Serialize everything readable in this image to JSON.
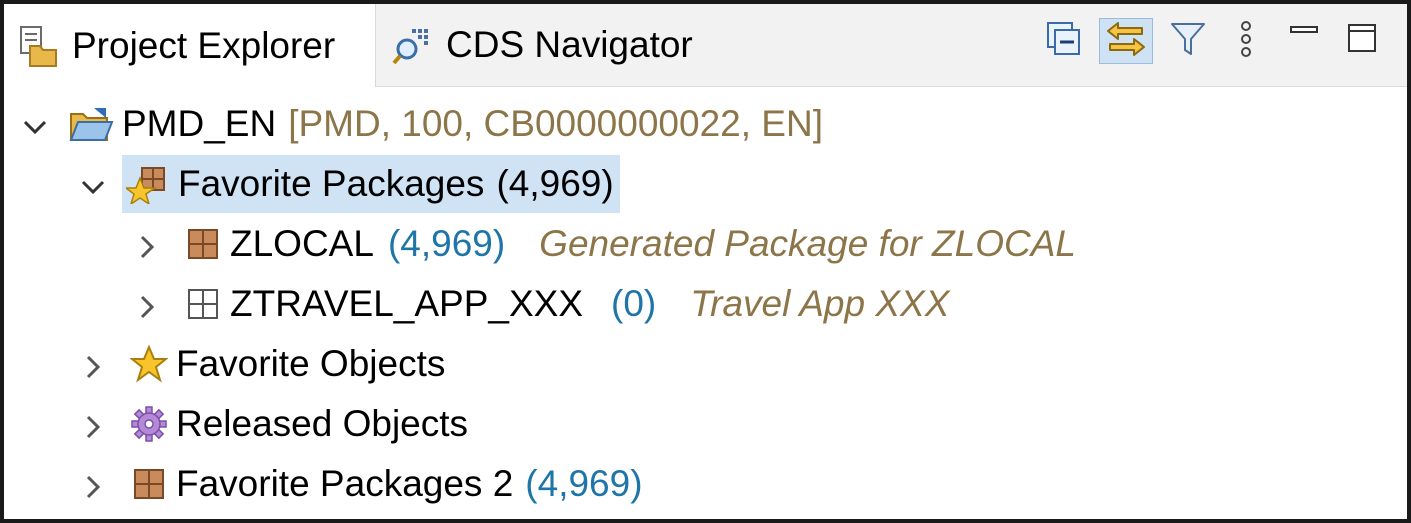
{
  "tabs": {
    "project_explorer": "Project Explorer",
    "cds_navigator": "CDS Navigator"
  },
  "toolbar": {
    "collapse_all": "collapse-all-icon",
    "link_with_editor": "link-with-editor-icon",
    "filter": "filter-icon",
    "view_menu": "view-menu-icon",
    "minimize": "minimize-icon",
    "maximize": "maximize-icon"
  },
  "tree": {
    "project": {
      "name": "PMD_EN",
      "decoration": "[PMD, 100, CB0000000022, EN]"
    },
    "favorite_packages": {
      "label": "Favorite Packages",
      "count": "(4,969)"
    },
    "zlocal": {
      "name": "ZLOCAL",
      "count": "(4,969)",
      "description": "Generated Package for ZLOCAL"
    },
    "ztravel": {
      "name": "ZTRAVEL_APP_XXX",
      "count": "(0)",
      "description": "Travel App XXX"
    },
    "favorite_objects": {
      "label": "Favorite Objects"
    },
    "released_objects": {
      "label": "Released Objects"
    },
    "favorite_packages_2": {
      "label": "Favorite Packages 2",
      "count": "(4,969)"
    }
  },
  "colors": {
    "count": "#1f74a8",
    "description": "#8c7548",
    "selection": "#cfe3f5",
    "tabbar": "#f2f2f2"
  }
}
